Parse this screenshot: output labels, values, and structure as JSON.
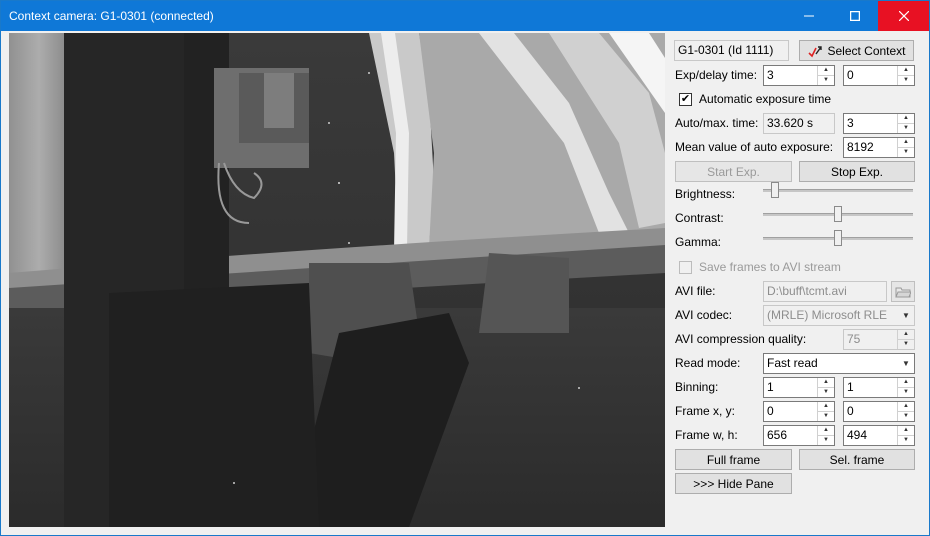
{
  "window": {
    "title": "Context camera: G1-0301 (connected)"
  },
  "controls": {
    "camera_id": "G1-0301 (Id 1111)",
    "select_context_label": "Select Context",
    "exp_delay_label": "Exp/delay time:",
    "exp_time_value": "3",
    "delay_value": "0",
    "auto_exposure_label": "Automatic exposure time",
    "auto_exposure_checked": true,
    "auto_max_label": "Auto/max. time:",
    "auto_time_value": "33.620 s",
    "max_time_value": "3",
    "mean_value_label": "Mean value of auto exposure:",
    "mean_value": "8192",
    "start_exp_label": "Start Exp.",
    "stop_exp_label": "Stop Exp.",
    "brightness_label": "Brightness:",
    "brightness_level": 0.08,
    "contrast_label": "Contrast:",
    "contrast_level": 0.5,
    "gamma_label": "Gamma:",
    "gamma_level": 0.5,
    "save_avi_label": "Save frames to AVI stream",
    "save_avi_checked": false,
    "avi_file_label": "AVI file:",
    "avi_file_value": "D:\\buff\\tcmt.avi",
    "avi_codec_label": "AVI codec:",
    "avi_codec_value": "(MRLE) Microsoft RLE",
    "avi_quality_label": "AVI compression quality:",
    "avi_quality_value": "75",
    "read_mode_label": "Read mode:",
    "read_mode_value": "Fast read",
    "binning_label": "Binning:",
    "binning_x": "1",
    "binning_y": "1",
    "frame_xy_label": "Frame x, y:",
    "frame_x": "0",
    "frame_y": "0",
    "frame_wh_label": "Frame w, h:",
    "frame_w": "656",
    "frame_h": "494",
    "full_frame_label": "Full frame",
    "sel_frame_label": "Sel. frame",
    "hide_pane_label": ">>> Hide Pane"
  },
  "colors": {
    "titlebar": "#0f78d7",
    "close_hover": "#e81123",
    "panel_bg": "#f0f0f0"
  }
}
